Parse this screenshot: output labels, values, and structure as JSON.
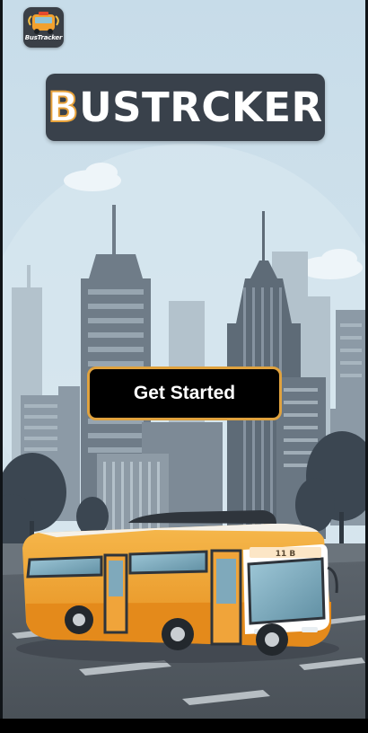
{
  "app_icon": {
    "name": "BusTracker",
    "icon": "bus-app-icon"
  },
  "logo": {
    "first_letter": "B",
    "rest": "USTRCKER"
  },
  "get_started_button": {
    "label": "Get Started"
  },
  "bus": {
    "route_sign": "11 B"
  },
  "colors": {
    "sky": "#cfe3ee",
    "banner": "#39414b",
    "accent": "#e0a23e",
    "bus_body": "#f2a12e",
    "button_bg": "#000000"
  }
}
